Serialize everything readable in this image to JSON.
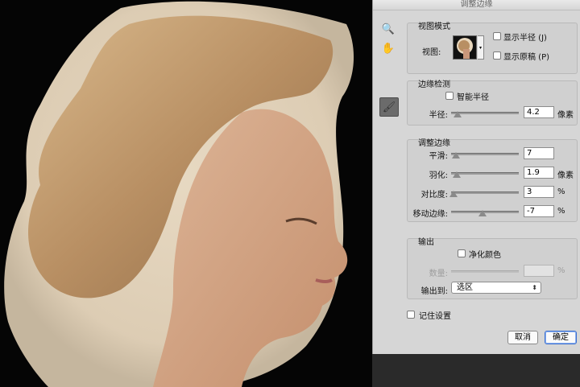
{
  "dialog": {
    "title": "调整边缘",
    "tools": [
      {
        "name": "zoom-icon",
        "glyph": "🔍"
      },
      {
        "name": "hand-icon",
        "glyph": "✋"
      },
      {
        "name": "refine-radius-brush-icon",
        "glyph": "🖌"
      }
    ],
    "view_mode": {
      "title": "视图模式",
      "view_label": "视图:",
      "show_radius": "显示半径 (J)",
      "show_original": "显示原稿 (P)"
    },
    "edge_detection": {
      "title": "边缘检测",
      "smart_radius": "智能半径",
      "radius_label": "半径:",
      "radius_value": "4.2",
      "radius_unit": "像素",
      "radius_level": 0.1
    },
    "adjust_edge": {
      "title": "调整边缘",
      "smooth_label": "平滑:",
      "smooth_value": "7",
      "smooth_level": 0.07,
      "feather_label": "羽化:",
      "feather_value": "1.9",
      "feather_unit": "像素",
      "feather_level": 0.08,
      "contrast_label": "对比度:",
      "contrast_value": "3",
      "contrast_unit": "%",
      "contrast_level": 0.03,
      "shift_label": "移动边缘:",
      "shift_value": "-7",
      "shift_unit": "%",
      "shift_level": 0.46
    },
    "output": {
      "title": "输出",
      "decontaminate": "净化颜色",
      "amount_label": "数量:",
      "amount_unit": "%",
      "output_to_label": "输出到:",
      "output_to_value": "选区"
    },
    "remember": "记住设置",
    "cancel": "取消",
    "ok": "确定"
  }
}
